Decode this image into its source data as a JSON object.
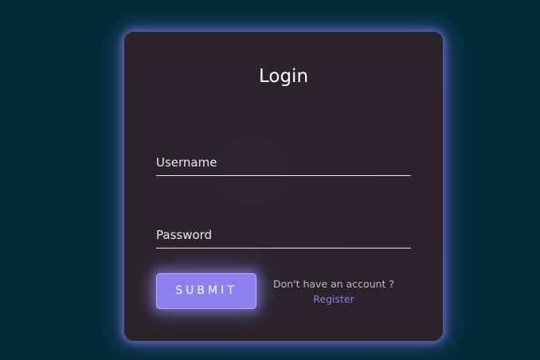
{
  "login": {
    "title": "Login",
    "username_label": "Username",
    "password_label": "Password",
    "submit_label": "SUBMIT",
    "account_prompt": "Don't have an account ?",
    "register_label": "Register"
  },
  "colors": {
    "background": "#022b37",
    "card": "#2b2329",
    "accent": "#8f80f2",
    "link": "#8d7fe6"
  }
}
